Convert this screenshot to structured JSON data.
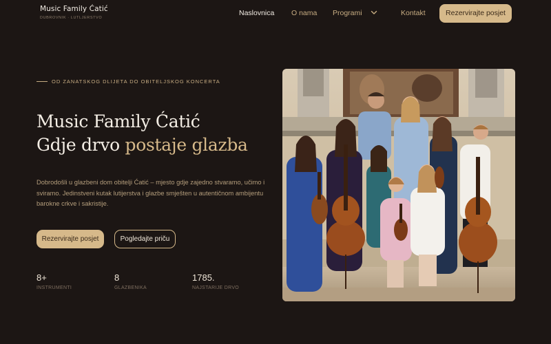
{
  "brand": {
    "name": "Music Family Ćatić",
    "subtitle": "DUBROVNIK · LUTLJERSTVO"
  },
  "nav": {
    "items": [
      {
        "label": "Naslovnica"
      },
      {
        "label": "O nama"
      },
      {
        "label": "Programi"
      },
      {
        "label": "Kontakt"
      }
    ],
    "cta": "Rezervirajte posjet"
  },
  "hero": {
    "eyebrow": "OD ZANATSKOG DLIJETA DO OBITELJSKOG KONCERTA",
    "title_line1": "Music Family Ćatić",
    "title_line2_a": "Gdje drvo ",
    "title_line2_b": "postaje glazba",
    "intro": "Dobrodošli u glazbeni dom obitelji Ćatić – mjesto gdje zajedno stvaramo, učimo i sviramo. Jedinstveni kutak lutijerstva i glazbe smješten u autentičnom ambijentu barokne crkve i sakristije.",
    "btn_primary": "Rezervirajte posjet",
    "btn_secondary": "Pogledajte priču"
  },
  "stats": [
    {
      "value": "8+",
      "label": "INSTRUMENTI"
    },
    {
      "value": "8",
      "label": "GLAZBENIKA"
    },
    {
      "value": "1785.",
      "label": "NAJSTARIJE DRVO"
    }
  ],
  "colors": {
    "background": "#1c1614",
    "accent": "#d6b98a",
    "accent_text": "#c8ad83"
  },
  "icons": {
    "dropdown": "chevron-down-icon"
  }
}
